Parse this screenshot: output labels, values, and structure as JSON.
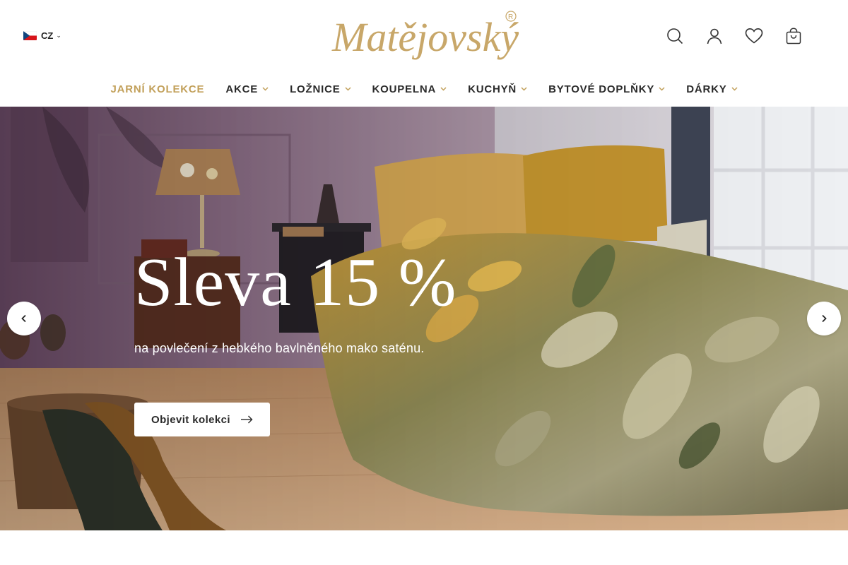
{
  "header": {
    "language": {
      "code": "CZ",
      "flag_icon": "czech-flag-icon"
    },
    "logo_text": "Matějovský",
    "logo_mark": "®",
    "icons": [
      "search-icon",
      "user-icon",
      "heart-icon",
      "cart-icon"
    ]
  },
  "nav": {
    "items": [
      {
        "label": "JARNÍ KOLEKCE",
        "has_dropdown": false,
        "accent": true
      },
      {
        "label": "AKCE",
        "has_dropdown": true
      },
      {
        "label": "LOŽNICE",
        "has_dropdown": true
      },
      {
        "label": "KOUPELNA",
        "has_dropdown": true
      },
      {
        "label": "KUCHYŇ",
        "has_dropdown": true
      },
      {
        "label": "BYTOVÉ DOPLŇKY",
        "has_dropdown": true
      },
      {
        "label": "DÁRKY",
        "has_dropdown": true
      }
    ]
  },
  "hero": {
    "title": "Sleva 15 %",
    "subtitle": "na povlečení z hebkého bavlněného mako saténu.",
    "cta_label": "Objevit kolekci"
  },
  "colors": {
    "accent_gold": "#c2a05a",
    "text_dark": "#2a2a2a",
    "white": "#ffffff"
  }
}
